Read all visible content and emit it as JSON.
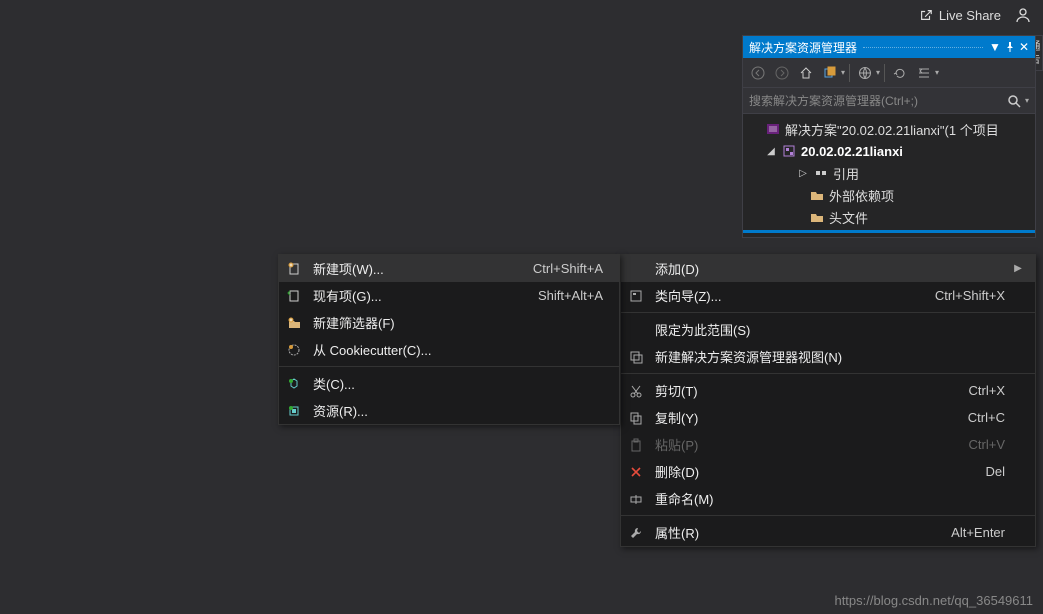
{
  "topbar": {
    "live_share": "Live Share"
  },
  "panel": {
    "title": "解决方案资源管理器",
    "search_placeholder": "搜索解决方案资源管理器(Ctrl+;)",
    "solution_label": "解决方案\"20.02.02.21lianxi\"(1 个项目",
    "project_label": "20.02.02.21lianxi",
    "refs_label": "引用",
    "external_label": "外部依赖项",
    "headers_label": "头文件"
  },
  "side_tab": "通告",
  "menu_right": {
    "add": {
      "label": "添加(D)"
    },
    "class_wizard": {
      "label": "类向导(Z)...",
      "shortcut": "Ctrl+Shift+X"
    },
    "scope": {
      "label": "限定为此范围(S)"
    },
    "new_view": {
      "label": "新建解决方案资源管理器视图(N)"
    },
    "cut": {
      "label": "剪切(T)",
      "shortcut": "Ctrl+X"
    },
    "copy": {
      "label": "复制(Y)",
      "shortcut": "Ctrl+C"
    },
    "paste": {
      "label": "粘贴(P)",
      "shortcut": "Ctrl+V"
    },
    "delete": {
      "label": "删除(D)",
      "shortcut": "Del"
    },
    "rename": {
      "label": "重命名(M)"
    },
    "properties": {
      "label": "属性(R)",
      "shortcut": "Alt+Enter"
    }
  },
  "menu_left": {
    "new_item": {
      "label": "新建项(W)...",
      "shortcut": "Ctrl+Shift+A"
    },
    "existing_item": {
      "label": "现有项(G)...",
      "shortcut": "Shift+Alt+A"
    },
    "new_filter": {
      "label": "新建筛选器(F)"
    },
    "cookiecutter": {
      "label": "从 Cookiecutter(C)..."
    },
    "class": {
      "label": "类(C)..."
    },
    "resource": {
      "label": "资源(R)..."
    }
  },
  "watermark": "https://blog.csdn.net/qq_36549611"
}
